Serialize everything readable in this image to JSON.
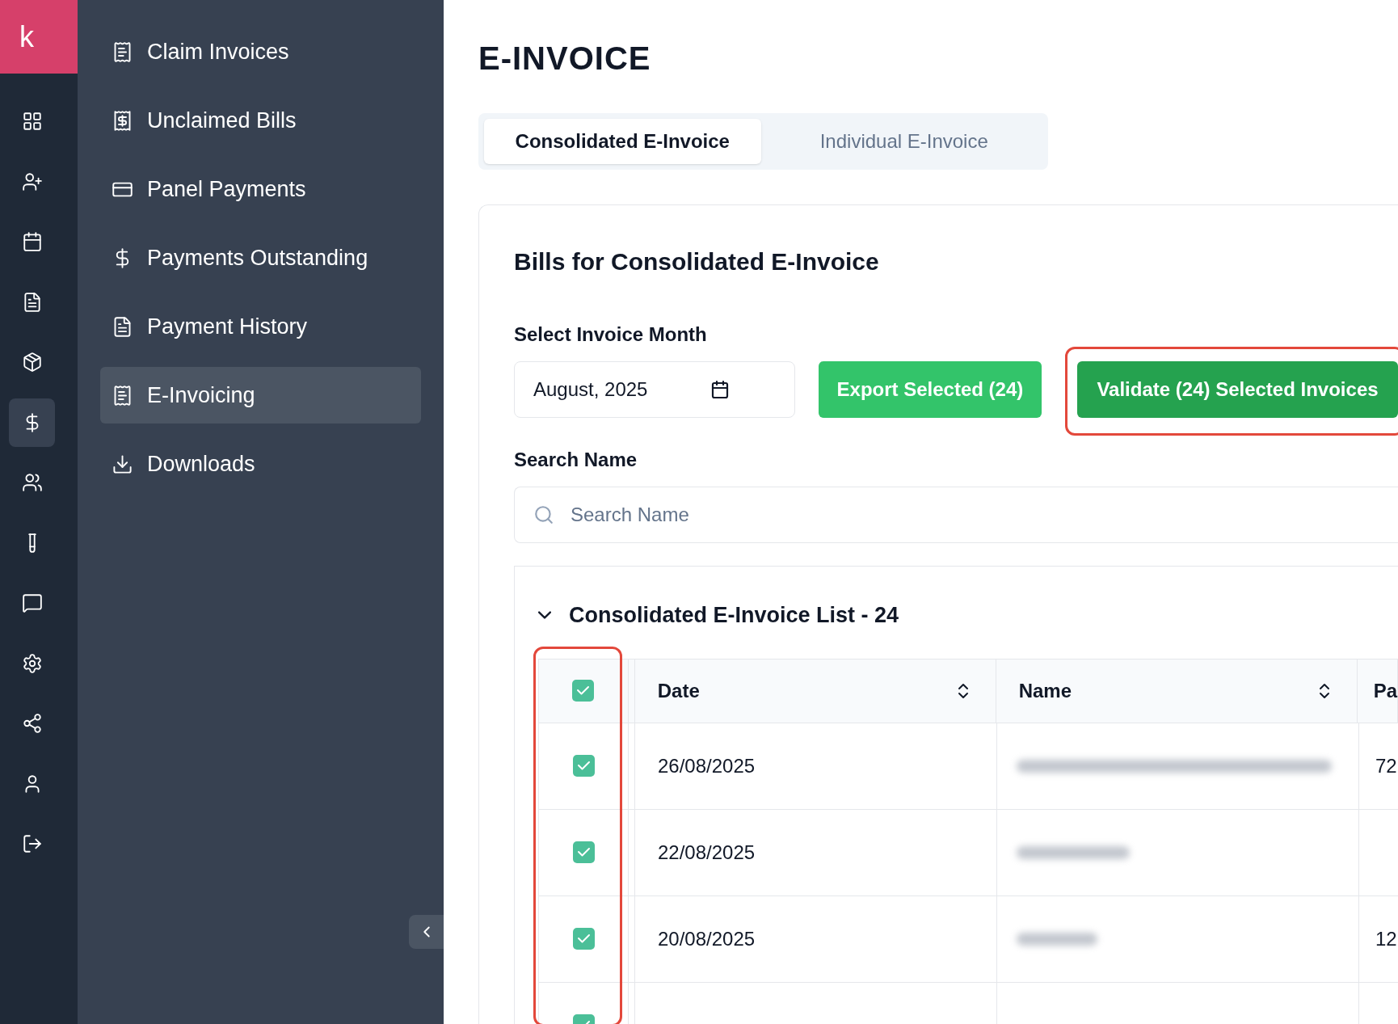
{
  "logo": {
    "letter": "k"
  },
  "rail": [
    {
      "selected": false
    },
    {
      "selected": false
    },
    {
      "selected": false
    },
    {
      "selected": false
    },
    {
      "selected": false
    },
    {
      "selected": true
    },
    {
      "selected": false
    },
    {
      "selected": false
    },
    {
      "selected": false
    },
    {
      "selected": false
    },
    {
      "selected": false
    },
    {
      "selected": false
    },
    {
      "selected": false
    }
  ],
  "sidebar": {
    "items": [
      {
        "label": "Claim Invoices",
        "selected": false
      },
      {
        "label": "Unclaimed Bills",
        "selected": false
      },
      {
        "label": "Panel Payments",
        "selected": false
      },
      {
        "label": "Payments Outstanding",
        "selected": false
      },
      {
        "label": "Payment History",
        "selected": false
      },
      {
        "label": "E-Invoicing",
        "selected": true
      },
      {
        "label": "Downloads",
        "selected": false
      }
    ]
  },
  "page": {
    "title": "E-INVOICE"
  },
  "tabs": [
    {
      "label": "Consolidated E-Invoice",
      "selected": true
    },
    {
      "label": "Individual E-Invoice",
      "selected": false
    }
  ],
  "card": {
    "title": "Bills for Consolidated E-Invoice",
    "month_label": "Select Invoice Month",
    "month_value": "August, 2025",
    "export_button": "Export Selected (24)",
    "validate_button": "Validate (24) Selected Invoices",
    "search_label": "Search Name",
    "search_placeholder": "Search Name",
    "list": {
      "title": "Consolidated E-Invoice List - 24",
      "expanded": true,
      "header_checked": true,
      "columns": [
        "Date",
        "Name",
        "Pa"
      ],
      "rows": [
        {
          "checked": true,
          "date": "26/08/2025",
          "column_3": "72"
        },
        {
          "checked": true,
          "date": "22/08/2025"
        },
        {
          "checked": true,
          "date": "20/08/2025",
          "column_3": "12"
        },
        {
          "checked": true
        }
      ]
    }
  }
}
